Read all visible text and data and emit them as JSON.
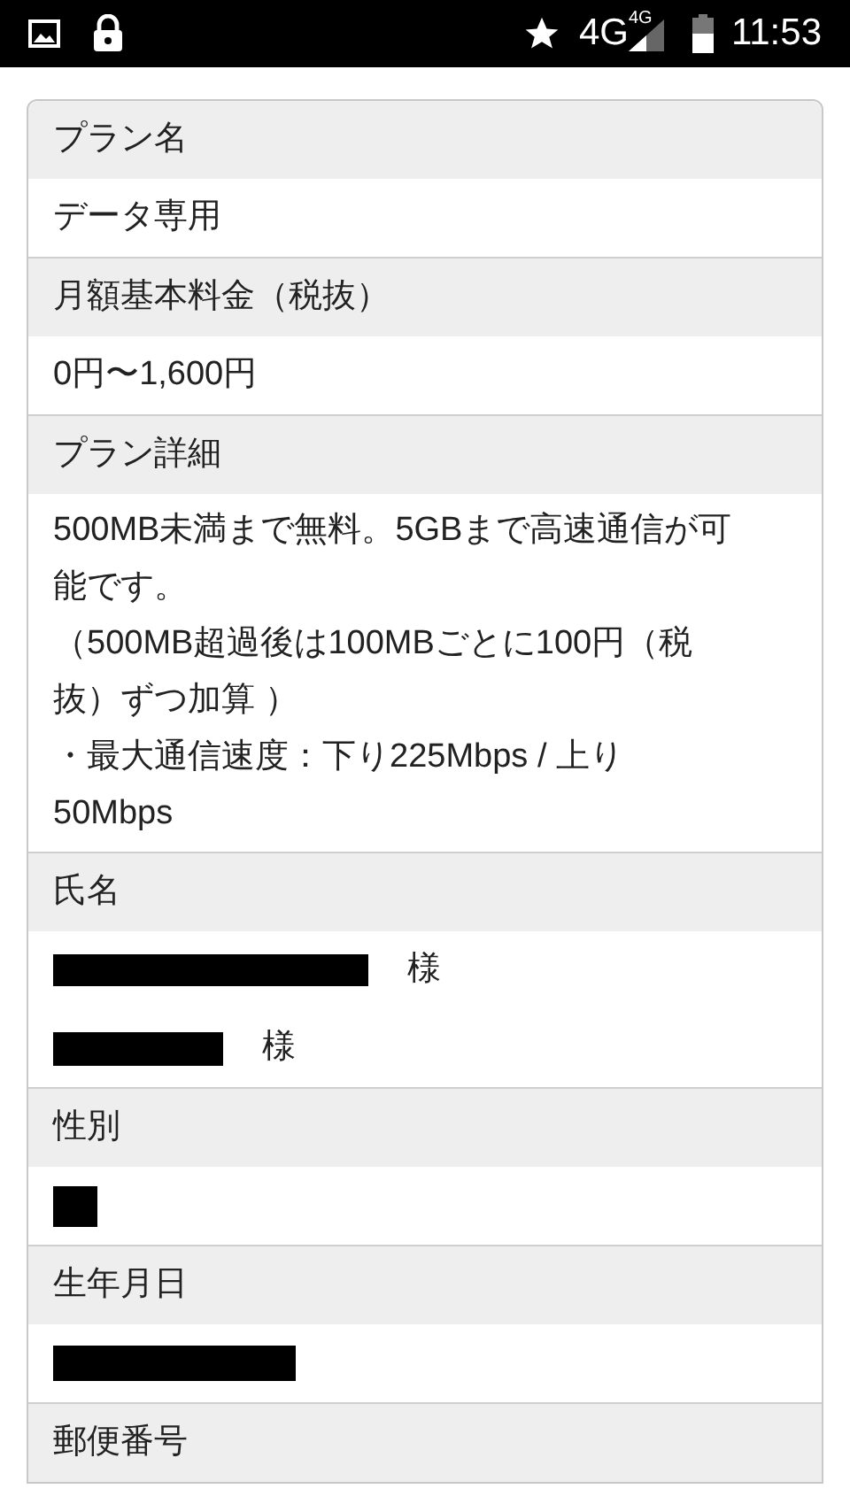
{
  "status_bar": {
    "network": "4G",
    "network_small": "4G",
    "time": "11:53"
  },
  "sections": [
    {
      "title": "プラン名",
      "items": [
        {
          "kind": "text",
          "text": "データ専用"
        }
      ]
    },
    {
      "title": "月額基本料金（税抜）",
      "items": [
        {
          "kind": "text",
          "text": "0円〜1,600円"
        }
      ]
    },
    {
      "title": "プラン詳細",
      "items": [
        {
          "kind": "paragraphs",
          "lines": [
            "500MB未満まで無料。5GBまで高速通信が可能です。",
            "（500MB超過後は100MBごとに100円（税抜）ずつ加算 ）",
            "・最大通信速度：下り225Mbps / 上り 50Mbps"
          ]
        }
      ]
    },
    {
      "title": "氏名",
      "items": [
        {
          "kind": "redacted-wide",
          "suffix": "様"
        },
        {
          "kind": "redacted-narrow",
          "suffix": "様"
        }
      ]
    },
    {
      "title": "性別",
      "items": [
        {
          "kind": "redacted-square"
        }
      ]
    },
    {
      "title": "生年月日",
      "items": [
        {
          "kind": "redacted-medium"
        }
      ]
    },
    {
      "title": "郵便番号"
    }
  ]
}
